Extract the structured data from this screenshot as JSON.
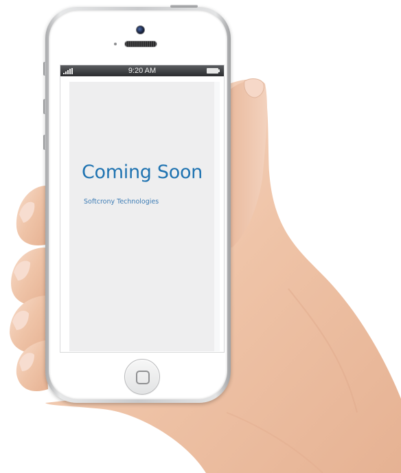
{
  "status_bar": {
    "time": "9:20 AM"
  },
  "screen": {
    "headline": "Coming Soon",
    "company": "Softcrony Technologies"
  },
  "icons": {
    "signal": "signal-bars-icon",
    "battery": "battery-icon",
    "camera": "front-camera-icon",
    "home": "home-button-icon"
  },
  "colors": {
    "headline": "#1f73b1",
    "company": "#3b7bb4",
    "screen_background": "#eeeeef",
    "status_bar": "#2b2c2f",
    "skin": "#f0c9ae"
  }
}
